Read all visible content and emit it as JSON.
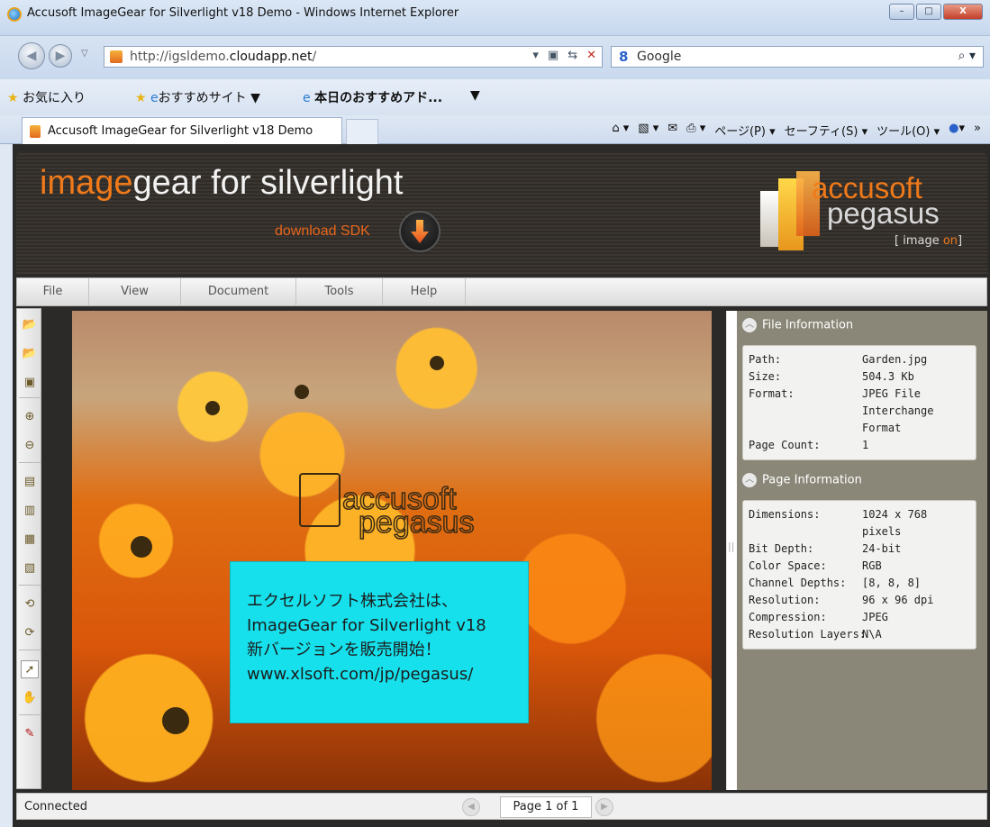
{
  "window": {
    "title": "Accusoft ImageGear for Silverlight v18 Demo - Windows Internet Explorer",
    "buttons": {
      "minimize": "–",
      "maximize": "□",
      "close": "X"
    }
  },
  "address": {
    "url_prefix": "http://igsldemo.",
    "url_domain": "cloudapp.net",
    "url_suffix": "/",
    "search_label": "Google"
  },
  "favorites": {
    "favorites_label": "お気に入り",
    "suggested_sites": "おすすめサイト ▼",
    "web_slice": "本日のおすすめアド...",
    "more": "▼"
  },
  "tabs": {
    "active_tab": "Accusoft ImageGear for Silverlight v18 Demo"
  },
  "commandbar": {
    "home": "▾",
    "feeds": "▾",
    "mail": "▾",
    "print": "▾",
    "page": "ページ(P) ▾",
    "safety": "セーフティ(S) ▾",
    "tools": "ツール(O) ▾",
    "help": "▾",
    "more": "»"
  },
  "banner": {
    "brand_highlight": "image",
    "brand_rest": "gear for silverlight",
    "download": "download SDK",
    "logo_line1": "accusoft",
    "logo_line2": "pegasus",
    "tagline_pre": "[ image ",
    "tagline_on": "on",
    "tagline_post": "]"
  },
  "menu": {
    "items": [
      "File",
      "View",
      "Document",
      "Tools",
      "Help"
    ]
  },
  "viewer": {
    "watermark_line1": "accusoft",
    "watermark_line2": "pegasus",
    "promo": [
      "エクセルソフト株式会社は、",
      "ImageGear for Silverlight v18",
      "新バージョンを販売開始！",
      "www.xlsoft.com/jp/pegasus/"
    ]
  },
  "file_info": {
    "title": "File Information",
    "rows": [
      {
        "k": "Path:",
        "v": "Garden.jpg"
      },
      {
        "k": "Size:",
        "v": "504.3 Kb"
      },
      {
        "k": "Format:",
        "v": "JPEG File Interchange Format"
      },
      {
        "k": "Page Count:",
        "v": "1"
      }
    ]
  },
  "page_info": {
    "title": "Page Information",
    "rows": [
      {
        "k": "Dimensions:",
        "v": "1024 x 768 pixels"
      },
      {
        "k": "Bit Depth:",
        "v": "24-bit"
      },
      {
        "k": "Color Space:",
        "v": "RGB"
      },
      {
        "k": "Channel Depths:",
        "v": "[8, 8, 8]"
      },
      {
        "k": "Resolution:",
        "v": "96 x 96 dpi"
      },
      {
        "k": "Compression:",
        "v": "JPEG"
      },
      {
        "k": "Resolution Layers:",
        "v": "N\\A"
      }
    ]
  },
  "status": {
    "text": "Connected",
    "page": "Page 1 of 1"
  }
}
